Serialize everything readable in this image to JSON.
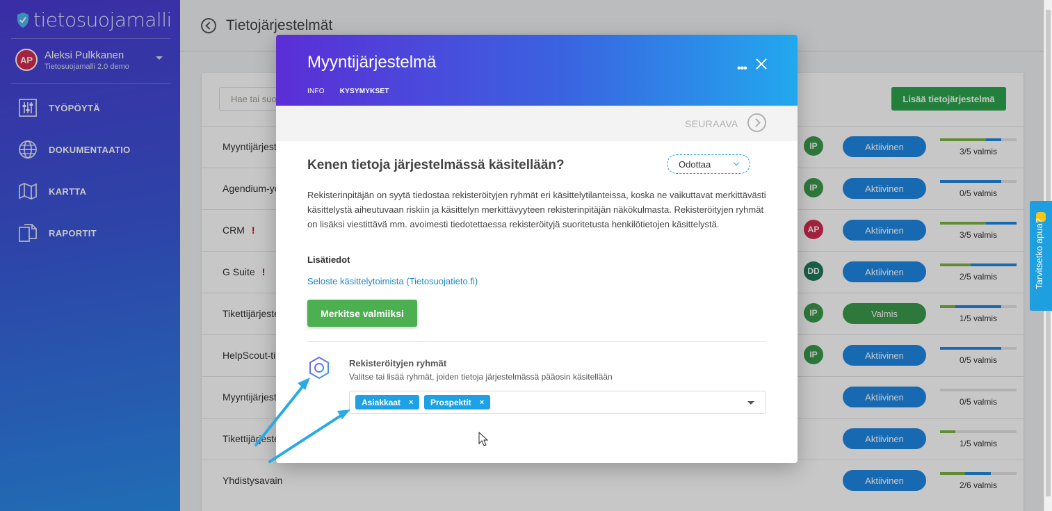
{
  "app": {
    "logo_text": "tietosuojamalli",
    "user_initials": "AP",
    "user_name": "Aleksi Pulkkanen",
    "user_org": "Tietosuojamalli 2.0 demo"
  },
  "sidebar": {
    "items": [
      {
        "label": "TYÖPÖYTÄ",
        "icon": "sliders-icon"
      },
      {
        "label": "DOKUMENTAATIO",
        "icon": "globe-icon"
      },
      {
        "label": "KARTTA",
        "icon": "map-icon"
      },
      {
        "label": "RAPORTIT",
        "icon": "documents-icon"
      }
    ]
  },
  "page": {
    "title": "Tietojärjestelmät",
    "search_placeholder": "Hae tai suo",
    "add_label": "Lisää tietojärjestelmä"
  },
  "table": {
    "rows": [
      {
        "name": "Myyntijärjest",
        "warn": "",
        "owner": "IP",
        "owner_color": "#3a9a4b",
        "status": "Aktiivinen",
        "status_color": "#1e88e5",
        "progress": "3/5 valmis",
        "green": 0.6,
        "blue": 0.8
      },
      {
        "name": "Agendium-yo",
        "warn": "",
        "owner": "IP",
        "owner_color": "#3a9a4b",
        "status": "Aktiivinen",
        "status_color": "#1e88e5",
        "progress": "0/5 valmis",
        "green": 0,
        "blue": 0.8
      },
      {
        "name": "CRM",
        "warn": "!",
        "owner": "AP",
        "owner_color": "#d52b4f",
        "status": "Aktiivinen",
        "status_color": "#1e88e5",
        "progress": "3/5 valmis",
        "green": 0.6,
        "blue": 1.0
      },
      {
        "name": "G Suite",
        "warn": "!",
        "owner": "DD",
        "owner_color": "#1f7a5a",
        "status": "Aktiivinen",
        "status_color": "#1e88e5",
        "progress": "2/5 valmis",
        "green": 0.4,
        "blue": 1.0
      },
      {
        "name": "Tikettijärjeste",
        "warn": "",
        "owner": "IP",
        "owner_color": "#3a9a4b",
        "status": "Valmis",
        "status_color": "#3a9a4b",
        "progress": "1/5 valmis",
        "green": 0.2,
        "blue": 0.8
      },
      {
        "name": "HelpScout-tik",
        "warn": "",
        "owner": "IP",
        "owner_color": "#3a9a4b",
        "status": "Aktiivinen",
        "status_color": "#1e88e5",
        "progress": "0/5 valmis",
        "green": 0,
        "blue": 0.8
      },
      {
        "name": "Myyntijärjest",
        "warn": "",
        "owner": "",
        "owner_color": "",
        "status": "Aktiivinen",
        "status_color": "#1e88e5",
        "progress": "0/5 valmis",
        "green": 0,
        "blue": 0
      },
      {
        "name": "Tikettijärjeste",
        "warn": "",
        "owner": "",
        "owner_color": "",
        "status": "Aktiivinen",
        "status_color": "#1e88e5",
        "progress": "1/5 valmis",
        "green": 0.2,
        "blue": 0.2
      },
      {
        "name": "Yhdistysavain",
        "warn": "",
        "owner": "",
        "owner_color": "",
        "status": "Aktiivinen",
        "status_color": "#1e88e5",
        "progress": "2/6 valmis",
        "green": 0.33,
        "blue": 0.66
      }
    ]
  },
  "modal": {
    "title": "Myyntijärjestelmä",
    "tabs": [
      "INFO",
      "KYSYMYKSET"
    ],
    "next_label": "SEURAAVA",
    "question": "Kenen tietoja järjestelmässä käsitellään?",
    "status": "Odottaa",
    "description": "Rekisterinpitäjän on syytä tiedostaa rekisteröityjen ryhmät eri käsittelytilanteissa, koska ne vaikuttavat merkittävästi käsittelystä aiheutuvaan riskiin ja käsittelyn merkittävyyteen rekisterinpitäjän näkökulmasta. Rekisteröityjen ryhmät on lisäksi viestittävä mm. avoimesti tiedotettaessa rekisteröityjä suoritetusta henkilötietojen käsittelystä.",
    "more_info": "Lisätiedot",
    "link": "Seloste käsittelytoimista (Tietosuojatieto.fi)",
    "mark_done": "Merkitse valmiiksi",
    "group_title": "Rekisteröityjen ryhmät",
    "group_desc": "Valitse tai lisää ryhmät, joiden tietoja järjestelmässä pääosin käsitellään",
    "tags": [
      "Asiakkaat",
      "Prospektit"
    ]
  },
  "help": {
    "label": "Tarvitsetko apua?"
  }
}
